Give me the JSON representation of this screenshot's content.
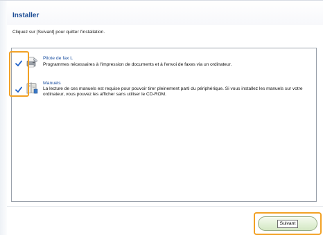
{
  "header": {
    "title": "Installer",
    "subtitle": "Cliquez sur [Suivant] pour quitter l'installation."
  },
  "components": [
    {
      "title": "Pilote de fax L",
      "description": "Programmes nécessaires à l'impression de documents et à l'envoi de faxes via un ordinateur.",
      "checked": true,
      "icon": "fax-driver-icon"
    },
    {
      "title": "Manuels",
      "description": "La lecture de ces manuels est requise pour pouvoir tirer pleinement parti du périphérique. Si vous installez les manuels sur votre ordinateur, vous pouvez les afficher sans utiliser le CD-ROM.",
      "checked": true,
      "icon": "manuals-book-icon"
    }
  ],
  "footer": {
    "next_label": "Suivant"
  },
  "colors": {
    "title": "#1f4f96",
    "item_title": "#1b4fa0",
    "check": "#1c5fc8",
    "highlight": "#f2a124",
    "button_top": "#f5fbef",
    "button_bottom": "#d3e7c3"
  }
}
